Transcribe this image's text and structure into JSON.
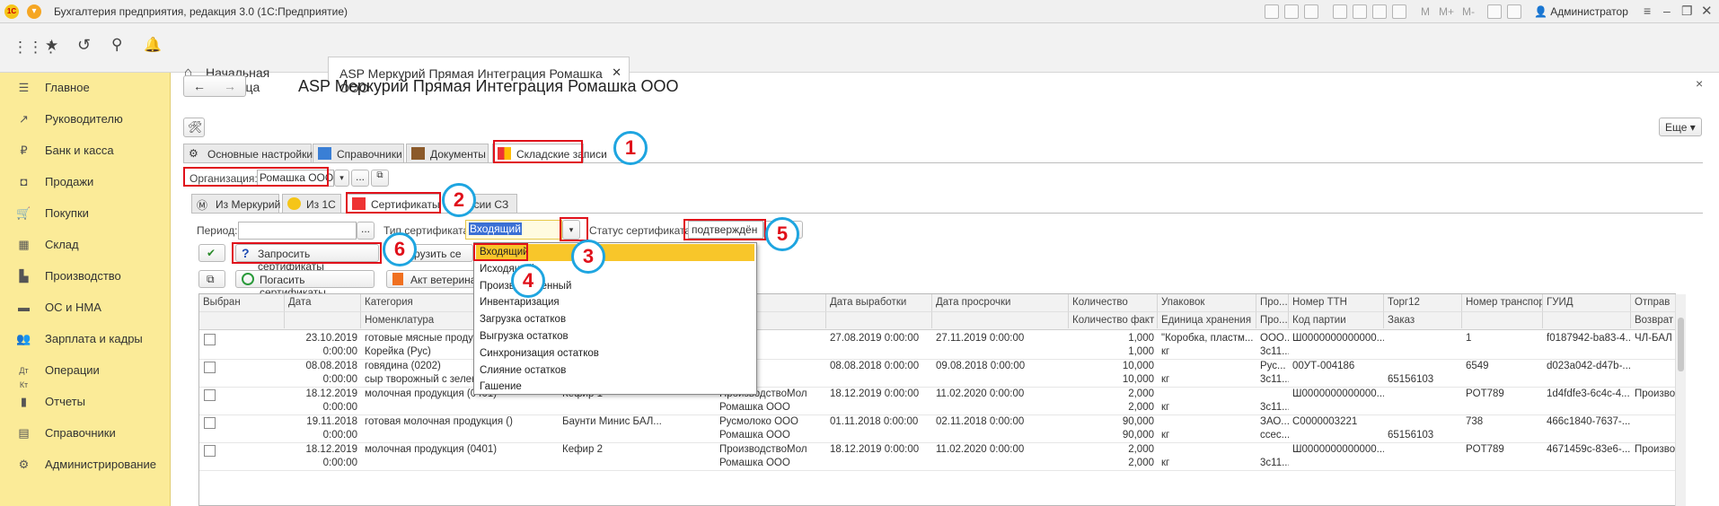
{
  "window": {
    "title": "Бухгалтерия предприятия, редакция 3.0  (1С:Предприятие)",
    "user": "Администратор",
    "m_labels": [
      "M",
      "M+",
      "M-"
    ]
  },
  "tabs": [
    {
      "label": "Начальная страница"
    },
    {
      "label": "ASP Меркурий Прямая Интеграция Ромашка ООО"
    }
  ],
  "sidebar": [
    {
      "label": "Главное",
      "icon": "menu-icon"
    },
    {
      "label": "Руководителю",
      "icon": "chart-icon"
    },
    {
      "label": "Банк и касса",
      "icon": "coin-icon"
    },
    {
      "label": "Продажи",
      "icon": "bag-icon"
    },
    {
      "label": "Покупки",
      "icon": "cart-icon"
    },
    {
      "label": "Склад",
      "icon": "warehouse-icon"
    },
    {
      "label": "Производство",
      "icon": "factory-icon"
    },
    {
      "label": "ОС и НМА",
      "icon": "truck-icon"
    },
    {
      "label": "Зарплата и кадры",
      "icon": "people-icon"
    },
    {
      "label": "Операции",
      "icon": "operations-icon"
    },
    {
      "label": "Отчеты",
      "icon": "report-icon"
    },
    {
      "label": "Справочники",
      "icon": "book-icon"
    },
    {
      "label": "Администрирование",
      "icon": "gear-icon"
    }
  ],
  "page": {
    "title": "ASP Меркурий Прямая Интеграция Ромашка ООО",
    "more_label": "Еще",
    "close": "×"
  },
  "main_tabs": [
    {
      "label": "Основные настройки"
    },
    {
      "label": "Справочники"
    },
    {
      "label": "Документы"
    },
    {
      "label": "Складские записи"
    }
  ],
  "org": {
    "label": "Организация:",
    "value": "Ромашка ООО",
    "more": "..."
  },
  "sub_tabs": [
    {
      "label": "Из Меркурий"
    },
    {
      "label": "Из 1С"
    },
    {
      "label": "Сертификаты"
    },
    {
      "label": "осии СЗ"
    }
  ],
  "filters": {
    "period_label": "Период:",
    "period_btn": "...",
    "type_label": "Тип сертификата:",
    "type_value": "Входящий",
    "status_label": "Статус сертификата:",
    "status_value": "подтверждён"
  },
  "buttons": {
    "request": "Запросить сертификаты",
    "load": "агрузить се",
    "repay": "Погасить сертификаты",
    "act": "Акт ветеринa"
  },
  "dropdown": [
    "Входящий",
    "Исходящий",
    "Производственный",
    "Инвентаризация",
    "Загрузка остатков",
    "Выгрузка остатков",
    "Синхронизация остатков",
    "Слияние остатков",
    "Гашение"
  ],
  "markers": [
    "1",
    "2",
    "3",
    "4",
    "5",
    "6"
  ],
  "grid": {
    "headers1": [
      "Выбран",
      "Дата",
      "Категория",
      "",
      "ель",
      "Дата выработки",
      "Дата просрочки",
      "Количество",
      "Упаковок",
      "Про...",
      "Номер ТТН",
      "Торг12",
      "Номер транспорта",
      "ГУИД",
      "Отправ"
    ],
    "headers2": [
      "",
      "",
      "Номенклатура",
      "",
      "ель",
      "",
      "",
      "Количество факт",
      "Единица хранения",
      "Про...",
      "Код партии",
      "Заказ",
      "",
      "",
      "Возврат"
    ],
    "rows": [
      {
        "r1": [
          "",
          "23.10.2019",
          "готовые мясные продукты",
          "",
          "ИЯ",
          "27.08.2019 0:00:00",
          "27.11.2019 0:00:00",
          "1,000",
          "\"Коробка, пластм...",
          "ООО...",
          "Ш0000000000000...",
          "",
          "1",
          "f0187942-ba83-4...",
          "ЧЛ-БАЛ"
        ],
        "r2": [
          "",
          "0:00:00",
          "Корейка (Рус)",
          "",
          "",
          "",
          "",
          "1,000",
          "кг",
          "3с11...",
          "",
          "",
          "",
          "",
          ""
        ]
      },
      {
        "r1": [
          "",
          "08.08.2018",
          "говядина (0202)",
          "",
          "ко ООО",
          "08.08.2018 0:00:00",
          "09.08.2018 0:00:00",
          "10,000",
          "",
          "Рус...",
          "00УТ-004186",
          "",
          "6549",
          "d023a042-d47b-...",
          ""
        ],
        "r2": [
          "",
          "0:00:00",
          "сыр творожный с зелен",
          "",
          "ко ООО",
          "",
          "",
          "10,000",
          "кг",
          "3с11...",
          "",
          "65156103",
          "",
          "",
          ""
        ]
      },
      {
        "r1": [
          "",
          "18.12.2019",
          "молочная продукция (0401)",
          "Кефир 1",
          "ПроизводствоМол",
          "18.12.2019 0:00:00",
          "11.02.2020 0:00:00",
          "2,000",
          "",
          "",
          "Ш0000000000000...",
          "",
          "POT789",
          "1d4fdfe3-6c4c-4...",
          "Произво"
        ],
        "r2": [
          "",
          "0:00:00",
          "",
          "",
          "Ромашка ООО",
          "",
          "",
          "2,000",
          "кг",
          "3с11...",
          "",
          "",
          "",
          "",
          ""
        ]
      },
      {
        "r1": [
          "",
          "19.11.2018",
          "готовая молочная продукция ()",
          "Баунти Минис БАЛ...",
          "Русмолоко ООО",
          "01.11.2018 0:00:00",
          "02.11.2018 0:00:00",
          "90,000",
          "",
          "ЗАО...",
          "С0000003221",
          "",
          "738",
          "466c1840-7637-...",
          ""
        ],
        "r2": [
          "",
          "0:00:00",
          "",
          "",
          "Ромашка ООО",
          "",
          "",
          "90,000",
          "кг",
          "ссес...",
          "",
          "65156103",
          "",
          "",
          ""
        ]
      },
      {
        "r1": [
          "",
          "18.12.2019",
          "молочная продукция (0401)",
          "Кефир 2",
          "ПроизводствоМол",
          "18.12.2019 0:00:00",
          "11.02.2020 0:00:00",
          "2,000",
          "",
          "",
          "Ш0000000000000...",
          "",
          "POT789",
          "4671459c-83e6-...",
          "Произво"
        ],
        "r2": [
          "",
          "0:00:00",
          "",
          "",
          "Ромашка ООО",
          "",
          "",
          "2,000",
          "кг",
          "3с11...",
          "",
          "",
          "",
          "",
          ""
        ]
      }
    ]
  }
}
